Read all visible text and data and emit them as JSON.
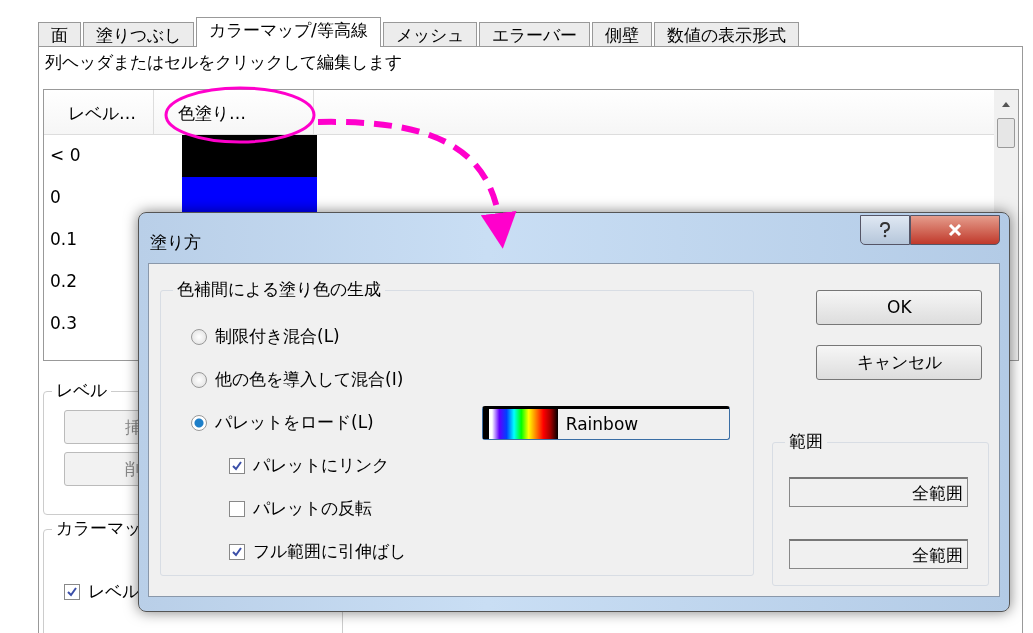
{
  "tabs": [
    {
      "label": "面",
      "selected": false
    },
    {
      "label": "塗りつぶし",
      "selected": false
    },
    {
      "label": "カラーマップ/等高線",
      "selected": true
    },
    {
      "label": "メッシュ",
      "selected": false
    },
    {
      "label": "エラーバー",
      "selected": false
    },
    {
      "label": "側壁",
      "selected": false
    },
    {
      "label": "数値の表示形式",
      "selected": false
    }
  ],
  "hint": "列ヘッダまたはセルをクリックして編集します",
  "table": {
    "columns": [
      "レベル…",
      "色塗り…"
    ],
    "rows": [
      {
        "level": "< 0",
        "color": "#000000"
      },
      {
        "level": "0",
        "color": "#0000ff"
      },
      {
        "level": "0.1"
      },
      {
        "level": "0.2"
      },
      {
        "level": "0.3"
      }
    ]
  },
  "level_group": {
    "title": "レベル",
    "buttons": [
      "挿",
      "削"
    ]
  },
  "colormap_group": {
    "title": "カラーマッ",
    "checkbox": {
      "label": "レベル",
      "checked": true
    }
  },
  "dialog": {
    "title": "塗り方",
    "group": {
      "title": "色補間による塗り色の生成",
      "options": [
        {
          "label": "制限付き混合(L)",
          "selected": false
        },
        {
          "label": "他の色を導入して混合(I)",
          "selected": false
        },
        {
          "label": "パレットをロード(L)",
          "selected": true
        }
      ],
      "palette": {
        "name": "Rainbow"
      },
      "checkboxes": [
        {
          "label": "パレットにリンク",
          "checked": true
        },
        {
          "label": "パレットの反転",
          "checked": false
        },
        {
          "label": "フル範囲に引伸ばし",
          "checked": true
        }
      ]
    },
    "buttons": [
      "OK",
      "キャンセル"
    ],
    "range": {
      "title": "範囲",
      "fields": [
        "全範囲",
        "全範囲"
      ]
    }
  }
}
